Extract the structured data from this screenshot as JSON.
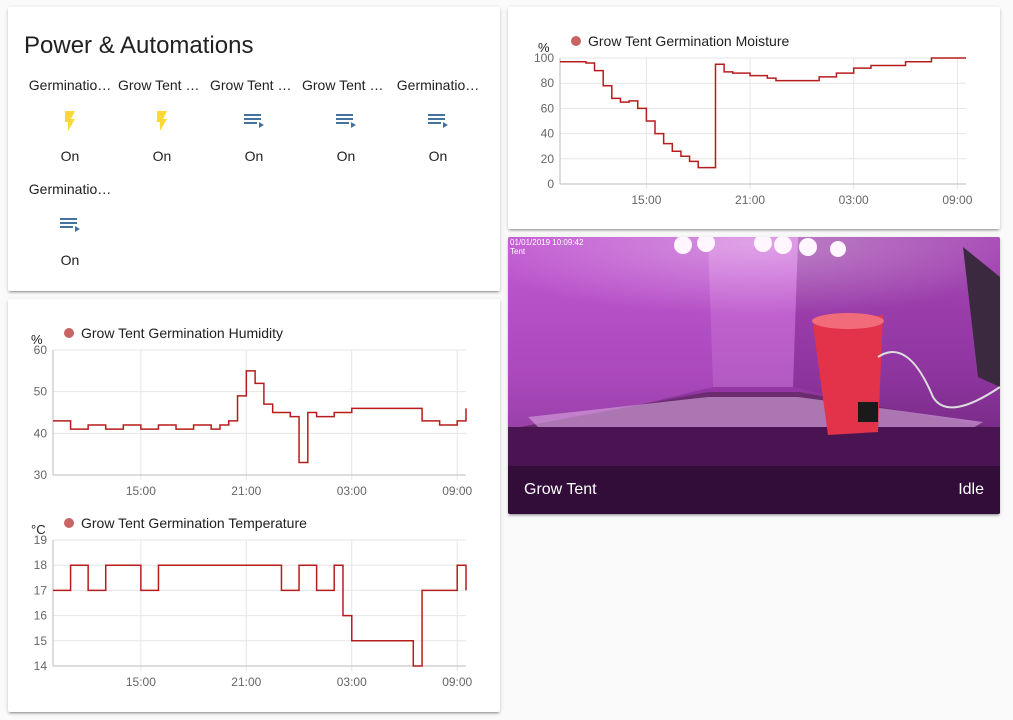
{
  "power_card": {
    "title": "Power & Automations",
    "entities": [
      {
        "name": "Germinatio…",
        "state": "On",
        "icon": "flash-icon",
        "icon_color": "#fdd835"
      },
      {
        "name": "Grow Tent L…",
        "state": "On",
        "icon": "flash-icon",
        "icon_color": "#fdd835"
      },
      {
        "name": "Grow Tent L…",
        "state": "On",
        "icon": "playlist-play-icon",
        "icon_color": "#44739e"
      },
      {
        "name": "Grow Tent L…",
        "state": "On",
        "icon": "playlist-play-icon",
        "icon_color": "#44739e"
      },
      {
        "name": "Germinatio…",
        "state": "On",
        "icon": "playlist-play-icon",
        "icon_color": "#44739e"
      },
      {
        "name": "Germinatio…",
        "state": "On",
        "icon": "playlist-play-icon",
        "icon_color": "#44739e"
      }
    ]
  },
  "camera": {
    "name": "Grow Tent",
    "state": "Idle",
    "overlay_timestamp": "01/01/2019 10:09:42",
    "overlay_label": "Tent"
  },
  "chart_data": [
    {
      "type": "line",
      "ylabel": "%",
      "legend": "Grow Tent Germination Moisture",
      "color": "#b71c1c",
      "ylim": [
        0,
        100
      ],
      "yticks": [
        "0",
        "20",
        "40",
        "60",
        "80",
        "100"
      ],
      "xlim": [
        10,
        33.5
      ],
      "xticks": [
        "15:00",
        "21:00",
        "03:00",
        "09:00"
      ],
      "xtick_values": [
        15,
        21,
        27,
        33
      ],
      "series": [
        {
          "x": [
            10.0,
            11.5,
            12.0,
            12.5,
            13.0,
            13.5,
            14.0,
            14.5,
            15.0,
            15.5,
            16.0,
            16.5,
            17.0,
            17.5,
            18.0,
            19.0,
            19.5,
            20.0,
            21.0,
            22.0,
            22.5,
            24.0,
            25.0,
            26.0,
            27.0,
            28.0,
            30.0,
            31.5,
            33.5
          ],
          "y": [
            97,
            96,
            90,
            78,
            68,
            65,
            66,
            60,
            50,
            40,
            32,
            26,
            22,
            18,
            13,
            95,
            89,
            88,
            86,
            84,
            82,
            82,
            85,
            88,
            92,
            94,
            97,
            100,
            100
          ]
        }
      ]
    },
    {
      "type": "line",
      "ylabel": "%",
      "legend": "Grow Tent Germination Humidity",
      "color": "#b71c1c",
      "ylim": [
        30,
        60
      ],
      "yticks": [
        "30",
        "40",
        "50",
        "60"
      ],
      "xlim": [
        10,
        33.5
      ],
      "xticks": [
        "15:00",
        "21:00",
        "03:00",
        "09:00"
      ],
      "xtick_values": [
        15,
        21,
        27,
        33
      ],
      "series": [
        {
          "x": [
            10.0,
            11.0,
            12.0,
            13.0,
            14.0,
            15.0,
            16.0,
            17.0,
            18.0,
            19.0,
            19.5,
            20.0,
            20.5,
            21.0,
            21.5,
            22.0,
            22.5,
            23.0,
            23.5,
            24.0,
            24.5,
            25.0,
            26.0,
            27.0,
            28.0,
            29.0,
            30.0,
            31.0,
            32.0,
            33.0,
            33.5
          ],
          "y": [
            43,
            41,
            42,
            41,
            42,
            41,
            42,
            41,
            42,
            41,
            42,
            43,
            49,
            55,
            52,
            47,
            45,
            45,
            44,
            33,
            45,
            44,
            45,
            46,
            46,
            46,
            46,
            43,
            42,
            43,
            46
          ]
        }
      ]
    },
    {
      "type": "line",
      "ylabel": "°C",
      "legend": "Grow Tent Germination Temperature",
      "color": "#b71c1c",
      "ylim": [
        14,
        19
      ],
      "yticks": [
        "14",
        "15",
        "16",
        "17",
        "18",
        "19"
      ],
      "xlim": [
        10,
        33.5
      ],
      "xticks": [
        "15:00",
        "21:00",
        "03:00",
        "09:00"
      ],
      "xtick_values": [
        15,
        21,
        27,
        33
      ],
      "series": [
        {
          "x": [
            10.0,
            10.5,
            11.0,
            12.0,
            13.0,
            14.0,
            15.0,
            16.0,
            17.0,
            18.0,
            19.0,
            20.0,
            21.0,
            22.0,
            23.0,
            24.0,
            25.0,
            26.0,
            26.5,
            27.0,
            28.0,
            29.0,
            30.0,
            30.5,
            31.0,
            32.0,
            33.0,
            33.5
          ],
          "y": [
            17,
            17,
            18,
            17,
            18,
            18,
            17,
            18,
            18,
            18,
            18,
            18,
            18,
            18,
            17,
            18,
            17,
            18,
            16,
            15,
            15,
            15,
            15,
            14,
            17,
            17,
            18,
            17
          ]
        }
      ]
    }
  ]
}
